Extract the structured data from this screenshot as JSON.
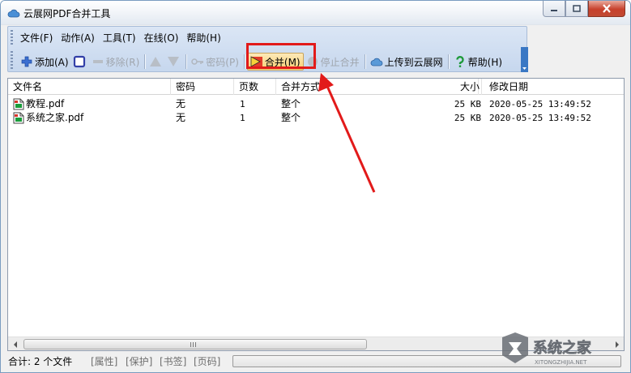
{
  "window": {
    "title": "云展网PDF合并工具"
  },
  "menu": [
    "文件(F)",
    "动作(A)",
    "工具(T)",
    "在线(O)",
    "帮助(H)"
  ],
  "toolbar": {
    "add": "添加(A)",
    "remove": "移除(R)",
    "password": "密码(P)",
    "merge": "合并(M)",
    "stop": "停止合并",
    "upload": "上传到云展网",
    "help": "帮助(H)"
  },
  "columns": {
    "name": "文件名",
    "password": "密码",
    "pages": "页数",
    "mode": "合并方式",
    "size": "大小",
    "modified": "修改日期"
  },
  "files": [
    {
      "name": "教程.pdf",
      "password": "无",
      "pages": "1",
      "mode": "整个",
      "size": "25 KB",
      "modified": "2020-05-25 13:49:52"
    },
    {
      "name": "系统之家.pdf",
      "password": "无",
      "pages": "1",
      "mode": "整个",
      "size": "25 KB",
      "modified": "2020-05-25 13:49:52"
    }
  ],
  "status": {
    "total": "合计: 2 个文件",
    "properties": "[属性]",
    "protect": "[保护]",
    "bookmark": "[书签]",
    "page": "[页码]"
  },
  "colors": {
    "highlight": "#e21a1a",
    "accent": "#3a78c4"
  }
}
